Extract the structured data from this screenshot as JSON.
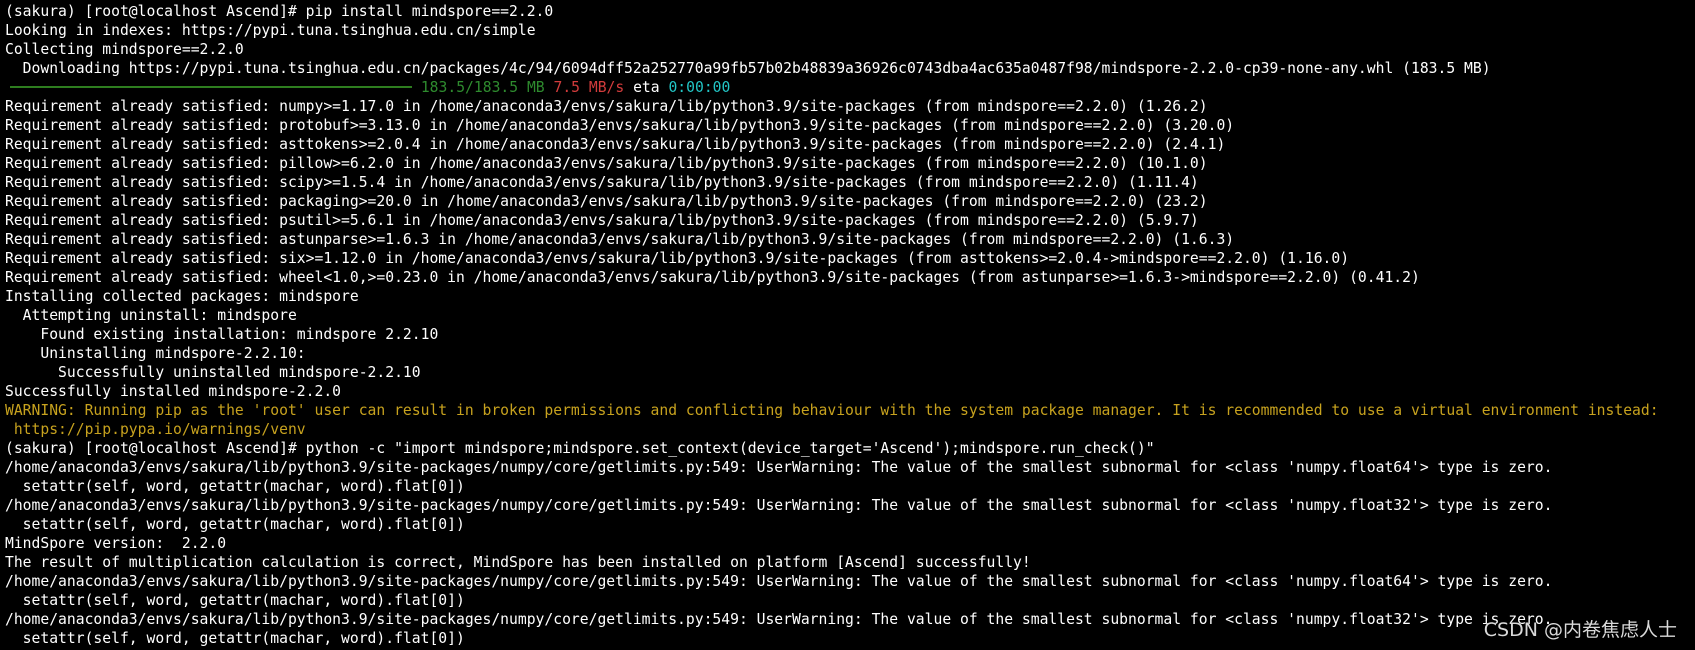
{
  "colors": {
    "background": "#000000",
    "text": "#ffffff",
    "progress_bar": "#2e7d1f",
    "progress_size": "#2e8b2e",
    "progress_rate": "#d23c3c",
    "progress_eta": "#22c6c6",
    "warning": "#c7a21e",
    "watermark": "#d9d9d9"
  },
  "terminal": {
    "progress": {
      "fraction": 1.0,
      "size": "183.5/183.5 MB",
      "rate": "7.5 MB/s",
      "eta_label": "eta",
      "eta_value": "0:00:00"
    },
    "lines": [
      {
        "id": "l01",
        "text": "(sakura) [root@localhost Ascend]# pip install mindspore==2.2.0"
      },
      {
        "id": "l02",
        "text": "Looking in indexes: https://pypi.tuna.tsinghua.edu.cn/simple"
      },
      {
        "id": "l03",
        "text": "Collecting mindspore==2.2.0"
      },
      {
        "id": "l04",
        "text": "  Downloading https://pypi.tuna.tsinghua.edu.cn/packages/4c/94/6094dff52a252770a99fb57b02b48839a36926c0743dba4ac635a0487f98/mindspore-2.2.0-cp39-none-any.whl (183.5 MB)"
      },
      {
        "id": "l05",
        "progress": true
      },
      {
        "id": "l06",
        "text": "Requirement already satisfied: numpy>=1.17.0 in /home/anaconda3/envs/sakura/lib/python3.9/site-packages (from mindspore==2.2.0) (1.26.2)"
      },
      {
        "id": "l07",
        "text": "Requirement already satisfied: protobuf>=3.13.0 in /home/anaconda3/envs/sakura/lib/python3.9/site-packages (from mindspore==2.2.0) (3.20.0)"
      },
      {
        "id": "l08",
        "text": "Requirement already satisfied: asttokens>=2.0.4 in /home/anaconda3/envs/sakura/lib/python3.9/site-packages (from mindspore==2.2.0) (2.4.1)"
      },
      {
        "id": "l09",
        "text": "Requirement already satisfied: pillow>=6.2.0 in /home/anaconda3/envs/sakura/lib/python3.9/site-packages (from mindspore==2.2.0) (10.1.0)"
      },
      {
        "id": "l10",
        "text": "Requirement already satisfied: scipy>=1.5.4 in /home/anaconda3/envs/sakura/lib/python3.9/site-packages (from mindspore==2.2.0) (1.11.4)"
      },
      {
        "id": "l11",
        "text": "Requirement already satisfied: packaging>=20.0 in /home/anaconda3/envs/sakura/lib/python3.9/site-packages (from mindspore==2.2.0) (23.2)"
      },
      {
        "id": "l12",
        "text": "Requirement already satisfied: psutil>=5.6.1 in /home/anaconda3/envs/sakura/lib/python3.9/site-packages (from mindspore==2.2.0) (5.9.7)"
      },
      {
        "id": "l13",
        "text": "Requirement already satisfied: astunparse>=1.6.3 in /home/anaconda3/envs/sakura/lib/python3.9/site-packages (from mindspore==2.2.0) (1.6.3)"
      },
      {
        "id": "l14",
        "text": "Requirement already satisfied: six>=1.12.0 in /home/anaconda3/envs/sakura/lib/python3.9/site-packages (from asttokens>=2.0.4->mindspore==2.2.0) (1.16.0)"
      },
      {
        "id": "l15",
        "text": "Requirement already satisfied: wheel<1.0,>=0.23.0 in /home/anaconda3/envs/sakura/lib/python3.9/site-packages (from astunparse>=1.6.3->mindspore==2.2.0) (0.41.2)"
      },
      {
        "id": "l16",
        "text": "Installing collected packages: mindspore"
      },
      {
        "id": "l17",
        "text": "  Attempting uninstall: mindspore"
      },
      {
        "id": "l18",
        "text": "    Found existing installation: mindspore 2.2.10"
      },
      {
        "id": "l19",
        "text": "    Uninstalling mindspore-2.2.10:"
      },
      {
        "id": "l20",
        "text": "      Successfully uninstalled mindspore-2.2.10"
      },
      {
        "id": "l21",
        "text": "Successfully installed mindspore-2.2.0"
      },
      {
        "id": "l22",
        "warning": true,
        "text": "WARNING: Running pip as the 'root' user can result in broken permissions and conflicting behaviour with the system package manager. It is recommended to use a virtual environment instead:"
      },
      {
        "id": "l23",
        "warning": true,
        "text": " https://pip.pypa.io/warnings/venv"
      },
      {
        "id": "l24",
        "text": "(sakura) [root@localhost Ascend]# python -c \"import mindspore;mindspore.set_context(device_target='Ascend');mindspore.run_check()\""
      },
      {
        "id": "l25",
        "text": "/home/anaconda3/envs/sakura/lib/python3.9/site-packages/numpy/core/getlimits.py:549: UserWarning: The value of the smallest subnormal for <class 'numpy.float64'> type is zero."
      },
      {
        "id": "l26",
        "text": "  setattr(self, word, getattr(machar, word).flat[0])"
      },
      {
        "id": "l27",
        "text": "/home/anaconda3/envs/sakura/lib/python3.9/site-packages/numpy/core/getlimits.py:549: UserWarning: The value of the smallest subnormal for <class 'numpy.float32'> type is zero."
      },
      {
        "id": "l28",
        "text": "  setattr(self, word, getattr(machar, word).flat[0])"
      },
      {
        "id": "l29",
        "text": "MindSpore version:  2.2.0"
      },
      {
        "id": "l30",
        "text": "The result of multiplication calculation is correct, MindSpore has been installed on platform [Ascend] successfully!"
      },
      {
        "id": "l31",
        "text": "/home/anaconda3/envs/sakura/lib/python3.9/site-packages/numpy/core/getlimits.py:549: UserWarning: The value of the smallest subnormal for <class 'numpy.float64'> type is zero."
      },
      {
        "id": "l32",
        "text": "  setattr(self, word, getattr(machar, word).flat[0])"
      },
      {
        "id": "l33",
        "text": "/home/anaconda3/envs/sakura/lib/python3.9/site-packages/numpy/core/getlimits.py:549: UserWarning: The value of the smallest subnormal for <class 'numpy.float32'> type is zero."
      },
      {
        "id": "l34",
        "text": "  setattr(self, word, getattr(machar, word).flat[0])"
      }
    ]
  },
  "watermark": {
    "text": "CSDN @内卷焦虑人士"
  }
}
